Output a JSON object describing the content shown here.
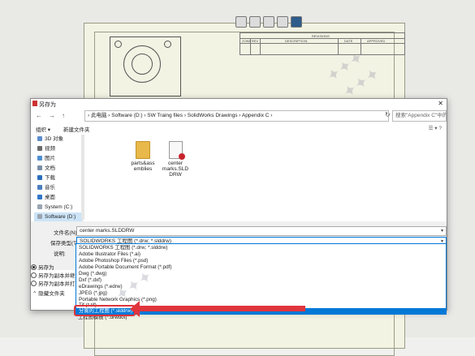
{
  "dialog": {
    "title": "另存为",
    "close": "✕",
    "nav": {
      "back": "←",
      "forward": "→",
      "up": "↑"
    },
    "address": "›  此电脑  ›  Software (D:)  ›  SW Traing files  ›  SolidWorks Drawings  ›  Appendix C  ›",
    "refresh": "↻",
    "search_placeholder": "搜索\"Appendix C\"中的文...",
    "organize": "组织 ▾",
    "new_folder": "新建文件夹",
    "view_icons": "☰ ▾  ?"
  },
  "sidebar": {
    "items": [
      {
        "label": "3D 对象",
        "color": "#5b8ccc"
      },
      {
        "label": "视频",
        "color": "#6a6a6a"
      },
      {
        "label": "图片",
        "color": "#4f8fcf"
      },
      {
        "label": "文档",
        "color": "#7a8ea6"
      },
      {
        "label": "下载",
        "color": "#2a6ebd"
      },
      {
        "label": "音乐",
        "color": "#4a7ec0"
      },
      {
        "label": "桌面",
        "color": "#3277c9"
      },
      {
        "label": "System (C:)",
        "color": "#9aa5b1"
      },
      {
        "label": "Software (D:)",
        "color": "#9aa5b1"
      }
    ]
  },
  "files": [
    {
      "name": "parts&assemblies",
      "line1": "parts&ass",
      "line2": "emblies",
      "type": "folder"
    },
    {
      "name": "center marks.SLDDRW",
      "line1": "center",
      "line2": "marks.SLD",
      "line3": "DRW",
      "type": "drawing"
    }
  ],
  "form": {
    "filename_label": "文件名(N):",
    "filename_value": "center marks.SLDDRW",
    "filetype_label": "保存类型(T):",
    "filetype_value": "SOLIDWORKS 工程图 (*.drw; *.slddrw)",
    "description_label": "说明:",
    "radio_save_as": "另存为",
    "radio_save_copy_continue": "另存为副本并继续",
    "radio_save_copy_open": "另存为副本并打开",
    "hide_folders": "隐藏文件夹"
  },
  "dropdown": {
    "options": [
      "SOLIDWORKS 工程图 (*.drw; *.slddrw)",
      "Adobe Illustrator Files (*.ai)",
      "Adobe Photoshop Files (*.psd)",
      "Adobe Portable Document Format (*.pdf)",
      "Dwg (*.dwg)",
      "Dxf (*.dxf)",
      "eDrawings (*.edrw)",
      "JPEG (*.jpg)",
      "Portable Network Graphics (*.png)",
      "Tif (*.tif)",
      "分离的工程图 (*.slddrw)",
      "工程图模板 (*.drwdot)"
    ],
    "highlighted": "分离的工程图 (*.slddrw)"
  },
  "revision_table": {
    "title": "REVISIONS",
    "headers": [
      "ZONE",
      "REV",
      "DESCRIPTION",
      "DATE",
      "APPROVED"
    ]
  },
  "colors": {
    "accent": "#0078d7",
    "callout": "#e0353d"
  }
}
